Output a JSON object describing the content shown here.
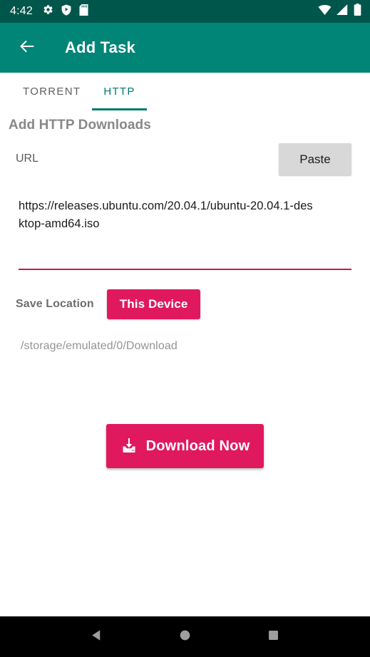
{
  "status_bar": {
    "clock": "4:42",
    "left_icons": [
      "gear-icon",
      "shield-play-icon",
      "sd-card-icon"
    ],
    "right_icons": [
      "wifi-icon",
      "cell-signal-icon",
      "battery-icon"
    ],
    "background_color": "#00564a"
  },
  "app_bar": {
    "back_label": "back-arrow-icon",
    "title": "Add Task",
    "background_color": "#008577"
  },
  "tabs": [
    {
      "label": "TORRENT",
      "active": false
    },
    {
      "label": "HTTP",
      "active": true
    }
  ],
  "tab_accent_color": "#00796b",
  "main": {
    "section_title": "Add HTTP Downloads",
    "url_label": "URL",
    "paste_button": "Paste",
    "url_value": "https://releases.ubuntu.com/20.04.1/ubuntu-20.04.1-desktop-amd64.iso",
    "url_placeholder": "",
    "url_underline_color": "#c2185b",
    "save_location_label": "Save Location",
    "save_location_button": "This Device",
    "save_path": "/storage/emulated/0/Download",
    "download_button": "Download Now",
    "accent_pink": "#e0195e"
  },
  "nav_bar": {
    "buttons": [
      "back-triangle-icon",
      "home-circle-icon",
      "recents-square-icon"
    ],
    "background_color": "#000000",
    "icon_color": "#9e9e9e"
  }
}
